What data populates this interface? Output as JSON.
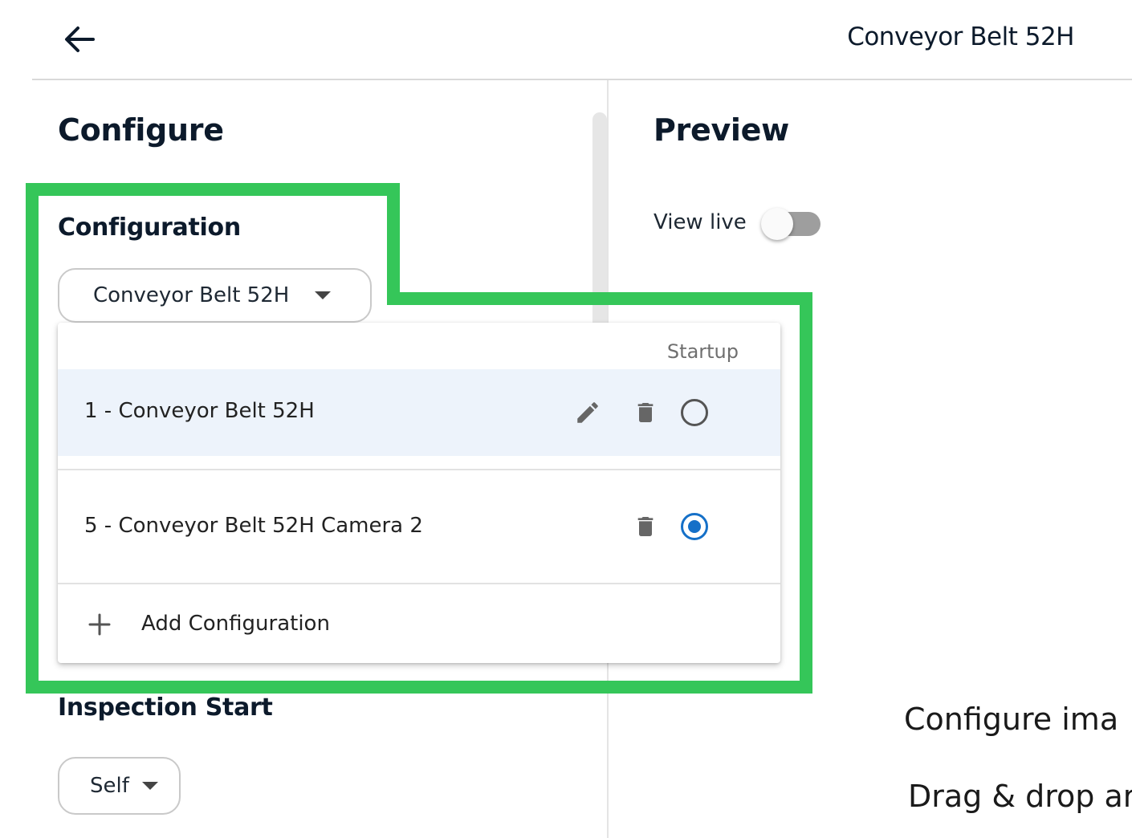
{
  "header": {
    "title": "Conveyor Belt 52H"
  },
  "configure": {
    "title": "Configure",
    "configuration_label": "Configuration",
    "selected_configuration": "Conveyor Belt 52H",
    "menu": {
      "column_header": "Startup",
      "items": [
        {
          "label": "1 - Conveyor Belt 52H",
          "editable": true,
          "startup": false,
          "selected": true
        },
        {
          "label": "5 - Conveyor Belt 52H Camera 2",
          "editable": false,
          "startup": true,
          "selected": false
        }
      ],
      "add_label": "Add Configuration"
    },
    "inspection_start_label": "Inspection Start",
    "inspection_start_value": "Self"
  },
  "preview": {
    "title": "Preview",
    "view_live_label": "View live",
    "view_live_on": false,
    "placeholder_line1": "Configure ima",
    "placeholder_line2": "Drag & drop ar"
  },
  "colors": {
    "highlight": "#35c659",
    "radio_selected": "#1570c8",
    "selected_row": "#edf3fb"
  }
}
